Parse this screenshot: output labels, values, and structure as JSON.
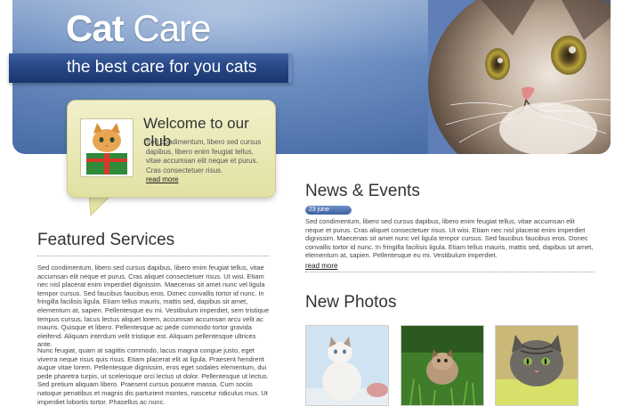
{
  "header": {
    "logo_bold": "Cat",
    "logo_light": " Care",
    "tagline": "the best care for you cats"
  },
  "welcome": {
    "title": "Welcome to our club",
    "text": "Sed condimentum, libero sed cursus dapibus, libero enim feugiat tellus, vitae accumsan elit neque et purus. Cras consectetuer risus.",
    "more": "read more"
  },
  "featured": {
    "title": "Featured Services",
    "paragraph1": "Sed condimentum, libero sed cursus dapibus, libero enim feugiat tellus, vitae accumsan elit neque et purus. Cras aliquet consectetuer risus. Ut wisi. Etiam nec nisl placerat enim imperdiet dignissim. Maecenas sit amet nunc vel ligula tempor cursus. Sed faucibus faucibus eros. Donec convallis tortor id nunc. In fringilla facilisis ligula. Etiam tellus mauris, mattis sed, dapibus sit amet, elementum at, sapien. Pellentesque eu mi. Vestibulum imperdiet, sem tristique tempus cursus, lacus lectus aliquet lorem, accumsan accumsan arcu velit ac mauris. Quisque et libero. Pellentesque ac pede commodo tortor gravida eleifend. Aliquam interdum velit tristique est. Aliquam pellentesque ultrices ante.",
    "paragraph2": "Nunc feugiat, quam at sagittis commodo, lacus magna congue justo, eget viverra neque risus quis risus. Etiam placerat elit at ligula. Praesent hendrerit augue vitae lorem. Pellentesque dignissim, eros eget sodales elementum, dui pede pharetra turpis, ut scelerisque orci lectus ut dolor. Pellentesque ut lectus. Sed pretium aliquam libero. Praesent cursus posuere massa. Cum sociis natoque penatibus et magnis dis parturient montes, nascetur ridiculus mus. Ut imperdiet lobortis tortor. Phasellus ac nunc."
  },
  "news": {
    "title": "News & Events",
    "date": "23 june",
    "text": "Sed condimentum, libero sed cursus dapibus, libero enim feugiat tellus, vitae accumsan elit neque et purus. Cras aliquet consectetuer risus. Ut wisi. Etiam nec nisl placerat enim imperdiet dignissim. Maecenas sit amet nunc vel ligula tempor cursus. Sed faucibus faucibus eros. Donec convallis tortor id nunc. In fringilla facilisis ligula. Etiam tellus mauris, mattis sed, dapibus sit amet, elementum at, sapien. Pellentesque eu mi. Vestibulum imperdiet.",
    "more": "read more"
  },
  "photos": {
    "title": "New Photos"
  },
  "colors": {
    "header_blue": "#4a6fa8",
    "tagline_bar": "#274785",
    "bubble_yellow": "#e2e1a4"
  }
}
